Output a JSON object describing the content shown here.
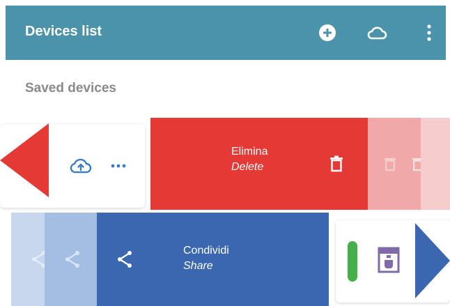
{
  "appbar": {
    "title": "Devices list"
  },
  "section": {
    "title": "Saved devices"
  },
  "row1": {
    "action_label_it": "Elimina",
    "action_label_en": "Delete"
  },
  "row2": {
    "action_label_it": "Condividi",
    "action_label_en": "Share"
  },
  "colors": {
    "appbar": "#4a93ab",
    "delete": "#e53935",
    "share": "#3b66b0",
    "status": "#43b04a",
    "device": "#7e6ba8"
  },
  "icons": [
    "add-circle-icon",
    "cloud-icon",
    "more-vertical-icon",
    "cloud-upload-icon",
    "more-horizontal-icon",
    "trash-icon",
    "share-icon",
    "coffee-machine-icon"
  ]
}
